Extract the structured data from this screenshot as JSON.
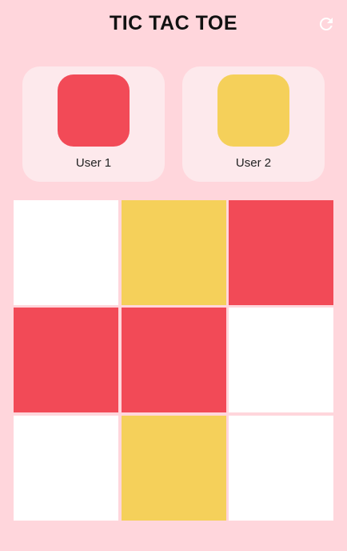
{
  "header": {
    "title": "TIC TAC TOE",
    "reset_icon": "refresh-icon"
  },
  "colors": {
    "background": "#ffd6dc",
    "card": "#fde9ec",
    "player1": "#f24a57",
    "player2": "#f5d05a",
    "empty": "#ffffff"
  },
  "players": [
    {
      "label": "User 1",
      "color": "#f24a57"
    },
    {
      "label": "User 2",
      "color": "#f5d05a"
    }
  ],
  "board": {
    "cells": [
      "empty",
      "player2",
      "player1",
      "player1",
      "player1",
      "empty",
      "empty",
      "player2",
      "empty"
    ]
  }
}
